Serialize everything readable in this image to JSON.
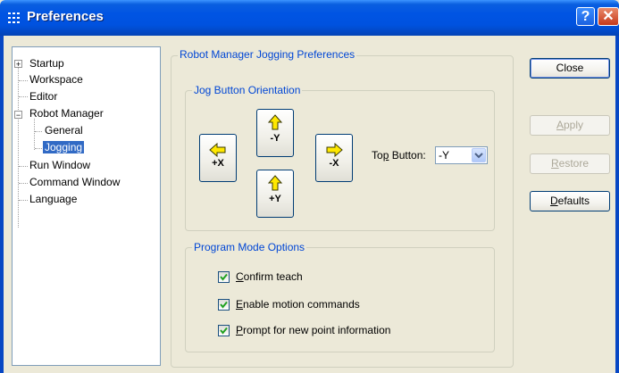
{
  "window": {
    "title": "Preferences",
    "help_label": "?",
    "close_label": "✕"
  },
  "tree": {
    "items": [
      {
        "label": "Startup",
        "expander": "+"
      },
      {
        "label": "Workspace"
      },
      {
        "label": "Editor"
      },
      {
        "label": "Robot Manager",
        "expander": "−"
      },
      {
        "label": "General"
      },
      {
        "label": "Jogging",
        "selected": true
      },
      {
        "label": "Run Window"
      },
      {
        "label": "Command Window"
      },
      {
        "label": "Language"
      }
    ]
  },
  "main": {
    "group_title": "Robot Manager Jogging Preferences",
    "jog": {
      "title": "Jog Button Orientation",
      "buttons": [
        {
          "label": "-Y",
          "arrow": "up-arrow"
        },
        {
          "label": "+X",
          "arrow": "left-arrow"
        },
        {
          "label": "-X",
          "arrow": "right-arrow"
        },
        {
          "label": "+Y",
          "arrow": "up-arrow"
        }
      ],
      "top_button_label_pre": "To",
      "top_button_label_u": "p",
      "top_button_label_post": " Button:",
      "top_button_value": "-Y"
    },
    "program": {
      "title": "Program Mode Options",
      "options": [
        {
          "u": "C",
          "rest": "onfirm teach",
          "checked": true
        },
        {
          "u": "E",
          "rest": "nable motion commands",
          "checked": true
        },
        {
          "u": "P",
          "rest": "rompt for new point information",
          "checked": true
        }
      ]
    }
  },
  "buttons": {
    "close": "Close",
    "apply_u": "A",
    "apply_rest": "pply",
    "restore_u": "R",
    "restore_rest": "estore",
    "defaults_u": "D",
    "defaults_rest": "efaults"
  },
  "colors": {
    "title_bar": "#0054e3",
    "dialog_bg": "#ece9d8",
    "selection": "#316ac5",
    "legend_text": "#0046d5",
    "arrow_fill": "#ffe800"
  }
}
